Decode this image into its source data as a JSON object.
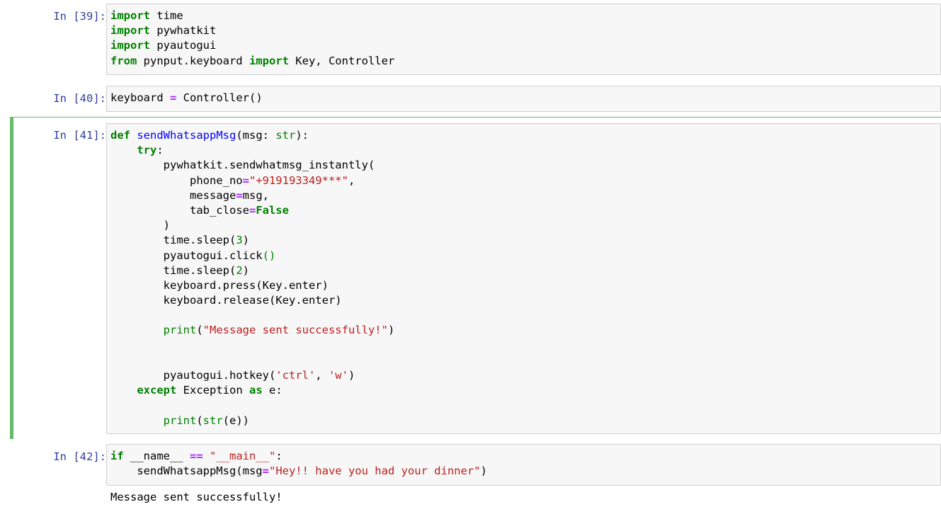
{
  "cells": [
    {
      "prompt": "In [39]:",
      "lines": [
        [
          [
            "kw",
            "import"
          ],
          [
            "t",
            " time"
          ]
        ],
        [
          [
            "kw",
            "import"
          ],
          [
            "t",
            " pywhatkit"
          ]
        ],
        [
          [
            "kw",
            "import"
          ],
          [
            "t",
            " pyautogui"
          ]
        ],
        [
          [
            "kw",
            "from"
          ],
          [
            "t",
            " pynput.keyboard "
          ],
          [
            "kw",
            "import"
          ],
          [
            "t",
            " Key, Controller"
          ]
        ]
      ]
    },
    {
      "prompt": "In [40]:",
      "lines": [
        [
          [
            "t",
            "keyboard "
          ],
          [
            "op",
            "="
          ],
          [
            "t",
            " Controller()"
          ]
        ]
      ]
    },
    {
      "prompt": "In [41]:",
      "lines": [
        [
          [
            "kw",
            "def"
          ],
          [
            "t",
            " "
          ],
          [
            "fn",
            "sendWhatsappMsg"
          ],
          [
            "t",
            "(msg: "
          ],
          [
            "bi",
            "str"
          ],
          [
            "t",
            "):"
          ]
        ],
        [
          [
            "t",
            "    "
          ],
          [
            "kw",
            "try"
          ],
          [
            "t",
            ":"
          ]
        ],
        [
          [
            "t",
            "        pywhatkit.sendwhatmsg_instantly("
          ]
        ],
        [
          [
            "t",
            "            phone_no"
          ],
          [
            "op",
            "="
          ],
          [
            "st",
            "\"+919193349***\""
          ],
          [
            "t",
            ","
          ]
        ],
        [
          [
            "t",
            "            message"
          ],
          [
            "op",
            "="
          ],
          [
            "t",
            "msg,"
          ]
        ],
        [
          [
            "t",
            "            tab_close"
          ],
          [
            "op",
            "="
          ],
          [
            "kw",
            "False"
          ]
        ],
        [
          [
            "t",
            "        )"
          ]
        ],
        [
          [
            "t",
            "        time.sleep("
          ],
          [
            "num",
            "3"
          ],
          [
            "t",
            ")"
          ]
        ],
        [
          [
            "t",
            "        pyautogui.click"
          ],
          [
            "bi",
            "()"
          ]
        ],
        [
          [
            "t",
            "        time.sleep("
          ],
          [
            "num",
            "2"
          ],
          [
            "t",
            ")"
          ]
        ],
        [
          [
            "t",
            "        keyboard.press(Key.enter)"
          ]
        ],
        [
          [
            "t",
            "        keyboard.release(Key.enter)"
          ]
        ],
        [
          [
            "t",
            ""
          ]
        ],
        [
          [
            "t",
            "        "
          ],
          [
            "bi",
            "print"
          ],
          [
            "t",
            "("
          ],
          [
            "st",
            "\"Message sent successfully!\""
          ],
          [
            "t",
            ")"
          ]
        ],
        [
          [
            "t",
            ""
          ]
        ],
        [
          [
            "t",
            ""
          ]
        ],
        [
          [
            "t",
            "        pyautogui.hotkey("
          ],
          [
            "st",
            "'ctrl'"
          ],
          [
            "t",
            ", "
          ],
          [
            "st",
            "'w'"
          ],
          [
            "t",
            ")"
          ]
        ],
        [
          [
            "t",
            "    "
          ],
          [
            "kw",
            "except"
          ],
          [
            "t",
            " Exception "
          ],
          [
            "kw",
            "as"
          ],
          [
            "t",
            " e:"
          ]
        ],
        [
          [
            "t",
            ""
          ]
        ],
        [
          [
            "t",
            "        "
          ],
          [
            "bi",
            "print"
          ],
          [
            "t",
            "("
          ],
          [
            "bi",
            "str"
          ],
          [
            "t",
            "(e))"
          ]
        ]
      ]
    },
    {
      "prompt": "In [42]:",
      "lines": [
        [
          [
            "kw",
            "if"
          ],
          [
            "t",
            " __name__ "
          ],
          [
            "op",
            "=="
          ],
          [
            "t",
            " "
          ],
          [
            "st",
            "\"__main__\""
          ],
          [
            "t",
            ":"
          ]
        ],
        [
          [
            "t",
            "    sendWhatsappMsg(msg"
          ],
          [
            "op",
            "="
          ],
          [
            "st",
            "\"Hey!! have you had your dinner\""
          ],
          [
            "t",
            ")"
          ]
        ]
      ]
    }
  ],
  "output_text": "Message sent successfully!",
  "colors": {
    "prompt": "#303f9f",
    "keyword": "#008000",
    "string": "#ba2121",
    "operator": "#aa22ff",
    "function": "#0000ff",
    "selected_border": "#66bb6a",
    "cell_bg": "#f7f7f7"
  }
}
